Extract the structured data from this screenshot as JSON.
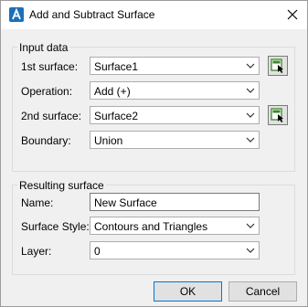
{
  "window": {
    "title": "Add and Subtract Surface",
    "close_icon": "close-icon",
    "app_icon": "autocad-civil-icon"
  },
  "input_data": {
    "group_title": "Input data",
    "first_surface": {
      "label": "1st surface:",
      "value": "Surface1"
    },
    "operation": {
      "label": "Operation:",
      "value": "Add (+)"
    },
    "second_surface": {
      "label": "2nd surface:",
      "value": "Surface2"
    },
    "boundary": {
      "label": "Boundary:",
      "value": "Union"
    }
  },
  "resulting_surface": {
    "group_title": "Resulting surface",
    "name": {
      "label": "Name:",
      "value": "New Surface"
    },
    "surface_style": {
      "label": "Surface Style:",
      "value": "Contours and Triangles"
    },
    "layer": {
      "label": "Layer:",
      "value": "0"
    }
  },
  "buttons": {
    "ok": "OK",
    "cancel": "Cancel"
  },
  "colors": {
    "accent": "#0078d7",
    "pick_icon_green": "#3a8a2a"
  }
}
